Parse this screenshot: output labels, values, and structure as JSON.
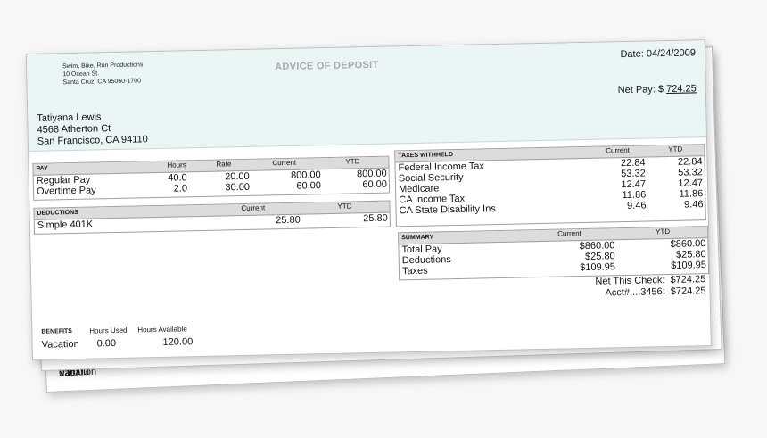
{
  "company": {
    "name": "Swim, Bike, Run Productions",
    "street": "10 Ocean St.",
    "city": "Santa Cruz, CA 95060-1700"
  },
  "title": "ADVICE OF DEPOSIT",
  "date_label": "Date:",
  "date": "04/24/2009",
  "net_pay_label": "Net Pay: $",
  "net_pay": "724.25",
  "employee": {
    "name": "Tatiyana Lewis",
    "street": "4568 Atherton Ct",
    "city": "San Francisco, CA 94110"
  },
  "pay": {
    "header": "PAY",
    "columns": [
      "Hours",
      "Rate",
      "Current",
      "YTD"
    ],
    "rows": [
      {
        "label": "Regular Pay",
        "hours": "40.0",
        "rate": "20.00",
        "current": "800.00",
        "ytd": "800.00"
      },
      {
        "label": "Overtime Pay",
        "hours": "2.0",
        "rate": "30.00",
        "current": "60.00",
        "ytd": "60.00"
      }
    ]
  },
  "deductions": {
    "header": "DEDUCTIONS",
    "columns": [
      "Current",
      "YTD"
    ],
    "rows": [
      {
        "label": "Simple 401K",
        "current": "25.80",
        "ytd": "25.80"
      }
    ]
  },
  "taxes": {
    "header": "TAXES WITHHELD",
    "columns": [
      "Current",
      "YTD"
    ],
    "rows": [
      {
        "label": "Federal Income Tax",
        "current": "22.84",
        "ytd": "22.84"
      },
      {
        "label": "Social Security",
        "current": "53.32",
        "ytd": "53.32"
      },
      {
        "label": "Medicare",
        "current": "12.47",
        "ytd": "12.47"
      },
      {
        "label": "CA Income Tax",
        "current": "11.86",
        "ytd": "11.86"
      },
      {
        "label": "CA State Disability Ins",
        "current": "9.46",
        "ytd": "9.46"
      }
    ]
  },
  "summary": {
    "header": "SUMMARY",
    "columns": [
      "Current",
      "YTD"
    ],
    "rows": [
      {
        "label": "Total Pay",
        "current": "$860.00",
        "ytd": "$860.00"
      },
      {
        "label": "Deductions",
        "current": "$25.80",
        "ytd": "$25.80"
      },
      {
        "label": "Taxes",
        "current": "$109.95",
        "ytd": "$109.95"
      }
    ]
  },
  "totals": {
    "net_check_label": "Net This Check:",
    "net_check": "$724.25",
    "acct_label": "Acct#....3456:",
    "acct": "$724.25"
  },
  "benefits": {
    "header": "BENEFITS",
    "columns": [
      "Hours Used",
      "Hours Available"
    ],
    "rows": [
      {
        "label": "Vacation",
        "used": "0.00",
        "available": "120.00"
      }
    ]
  }
}
